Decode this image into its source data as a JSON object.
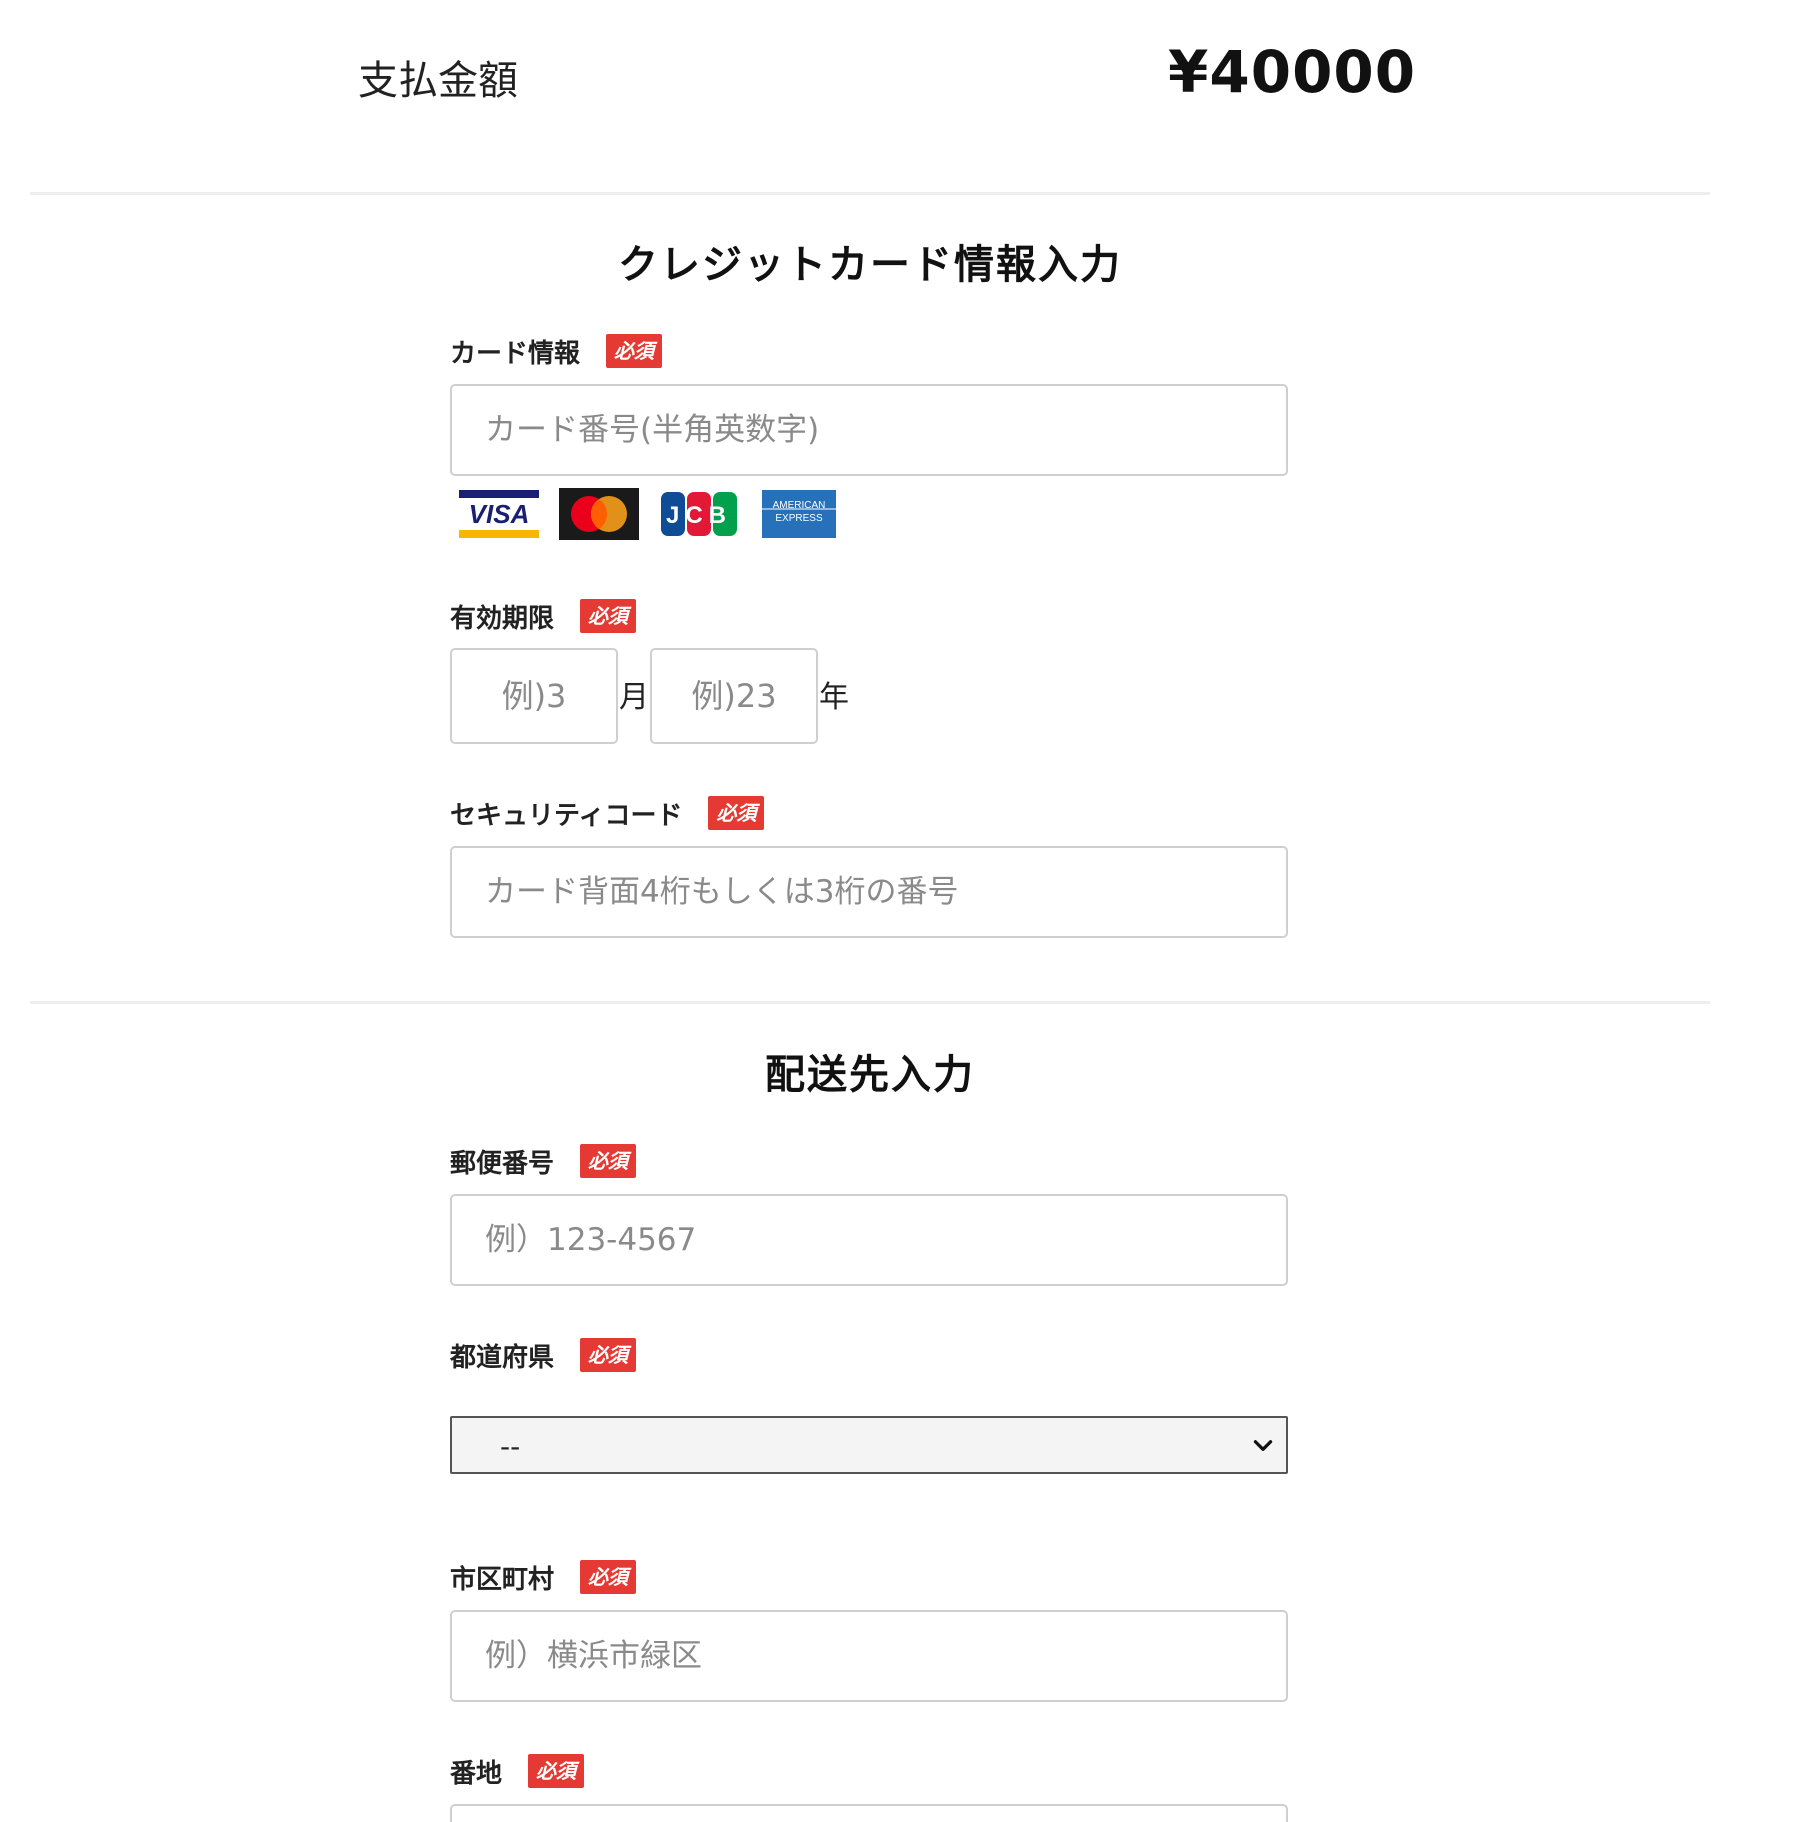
{
  "payment": {
    "amount_label": "支払金額",
    "amount_value": "¥40000"
  },
  "credit_section": {
    "title": "クレジットカード情報入力",
    "required_badge": "必須",
    "card_info": {
      "label": "カード情報",
      "placeholder": "カード番号(半角英数字)"
    },
    "card_brands": [
      {
        "name": "VISA",
        "icon": "visa-logo",
        "text": "VISA"
      },
      {
        "name": "Mastercard",
        "icon": "mastercard-logo"
      },
      {
        "name": "JCB",
        "icon": "jcb-logo",
        "text": "JCB"
      },
      {
        "name": "American Express",
        "icon": "amex-logo",
        "line1": "AMERICAN",
        "line2": "EXPRESS"
      }
    ],
    "expiry": {
      "label": "有効期限",
      "month_placeholder": "例)3",
      "month_unit": "月",
      "year_placeholder": "例)23",
      "year_unit": "年"
    },
    "security_code": {
      "label": "セキュリティコード",
      "placeholder": "カード背面4桁もしくは3桁の番号"
    }
  },
  "shipping_section": {
    "title": "配送先入力",
    "required_badge": "必須",
    "postal_code": {
      "label": "郵便番号",
      "placeholder": "例）123-4567"
    },
    "prefecture": {
      "label": "都道府県",
      "selected": "--",
      "icon": "chevron-down-icon"
    },
    "city": {
      "label": "市区町村",
      "placeholder": "例）横浜市緑区"
    },
    "address": {
      "label": "番地"
    }
  },
  "colors": {
    "required_badge_bg": "#e53a33",
    "input_border": "#cfcfcf",
    "placeholder": "#8a8a8a",
    "divider": "#eeeeee"
  }
}
